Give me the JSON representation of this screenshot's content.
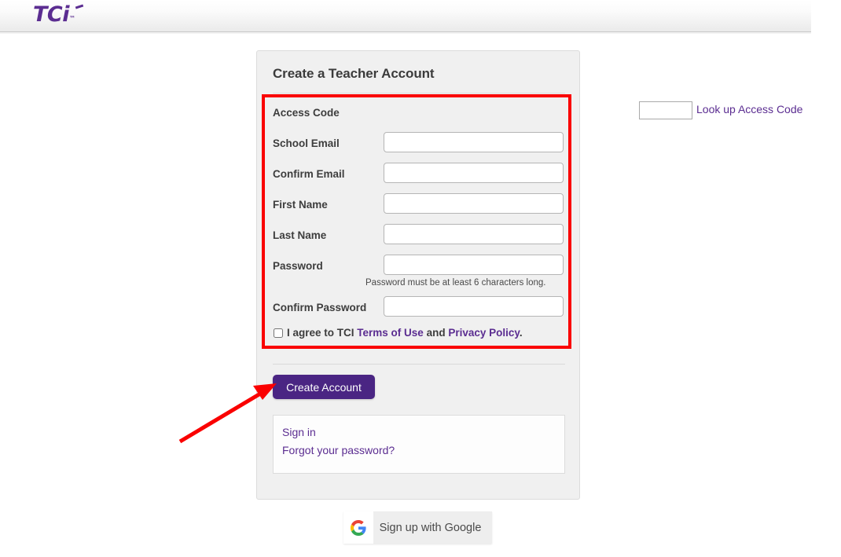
{
  "header": {
    "logo_text": "TCi",
    "logo_tm": "™",
    "logo_color": "#5b2d91"
  },
  "card": {
    "title": "Create a Teacher Account",
    "fields": [
      {
        "label": "Access Code",
        "value": "",
        "placeholder": ""
      },
      {
        "label": "School Email",
        "value": "",
        "placeholder": ""
      },
      {
        "label": "Confirm Email",
        "value": "",
        "placeholder": ""
      },
      {
        "label": "First Name",
        "value": "",
        "placeholder": ""
      },
      {
        "label": "Last Name",
        "value": "",
        "placeholder": ""
      },
      {
        "label": "Password",
        "value": "",
        "placeholder": ""
      },
      {
        "label": "Confirm Password",
        "value": "",
        "placeholder": ""
      }
    ],
    "lookup_link": "Look up Access Code",
    "password_hint": "Password must be at least 6 characters long.",
    "agree": {
      "prefix": "I agree to TCI ",
      "terms_link": "Terms of Use",
      "middle": " and ",
      "privacy_link": "Privacy Policy",
      "suffix": ".",
      "checked": false
    },
    "submit_label": "Create Account",
    "panel_links": [
      "Sign in",
      "Forgot your password?"
    ]
  },
  "google": {
    "label": "Sign up with Google",
    "icon": "google-g-icon"
  },
  "annotations": {
    "highlight_box_color": "#fa0000",
    "arrow_color": "#fa0000"
  }
}
